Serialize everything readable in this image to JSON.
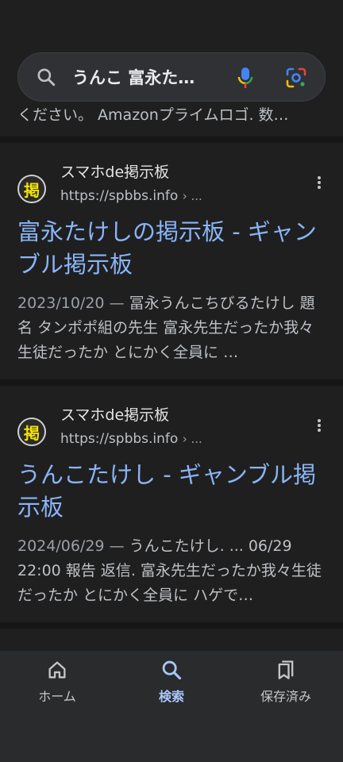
{
  "search": {
    "query": "うんこ 富永た…",
    "icons": {
      "search": "search-icon",
      "mic": "mic-icon",
      "lens": "lens-icon"
    }
  },
  "previous_result": {
    "snippet_tail": "ください。 Amazonプライムロゴ. 数…"
  },
  "results": [
    {
      "favicon_text": "掲",
      "site_name": "スマホde掲示板",
      "url": "https://spbbs.info",
      "breadcrumb": "› ...",
      "title": "富永たけしの掲示板 - ギャンブル掲示板",
      "date": "2023/10/20",
      "date_sep": "—",
      "snippet": "冨永うんこちびるたけし 題名 タンポポ組の先生 富永先生だったか我々生徒だったか とにかく全員に …"
    },
    {
      "favicon_text": "掲",
      "site_name": "スマホde掲示板",
      "url": "https://spbbs.info",
      "breadcrumb": "› ...",
      "title": "うんこたけし - ギャンブル掲示板",
      "date": "2024/06/29",
      "date_sep": "—",
      "snippet": "うんこたけし. ... 06/29 22:00 報告 返信. 富永先生だったか我々生徒だったか とにかく全員に ハゲで…"
    }
  ],
  "bottom_nav": {
    "items": [
      {
        "label": "ホーム",
        "icon": "home-icon"
      },
      {
        "label": "検索",
        "icon": "search-icon",
        "active": true
      },
      {
        "label": "保存済み",
        "icon": "saved-icon"
      }
    ]
  },
  "colors": {
    "background": "#1f1f1f",
    "link_title": "#8ab4f8",
    "active_nav": "#a8c7fa",
    "favicon_text": "#f3e300"
  }
}
